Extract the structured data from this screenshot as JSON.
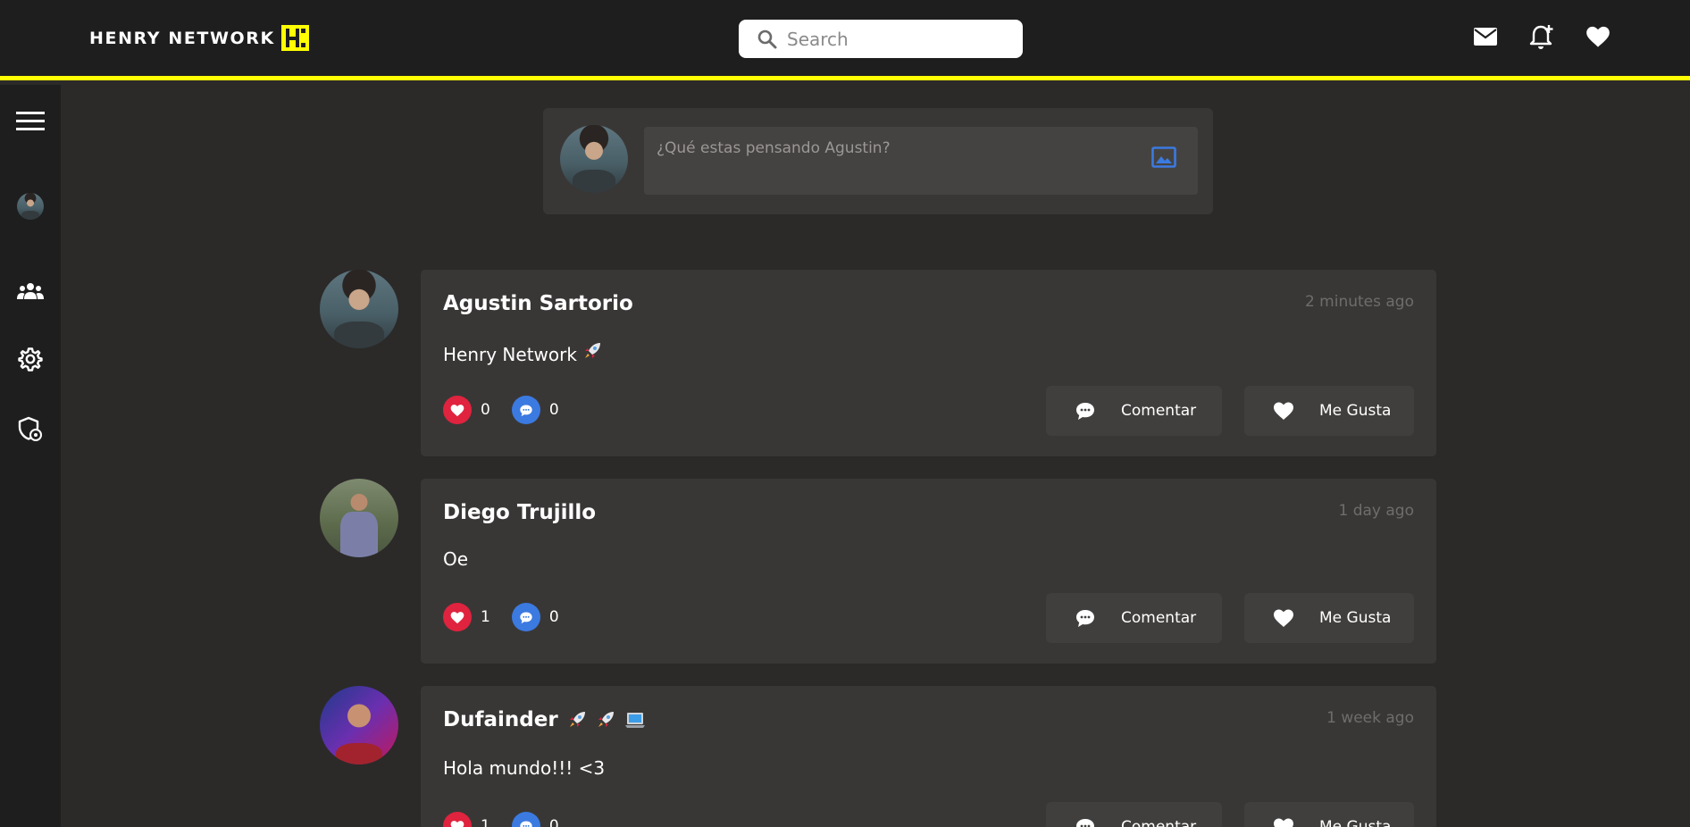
{
  "app": {
    "brand": "HENRY NETWORK",
    "accent_color": "#ffff01"
  },
  "header": {
    "search_placeholder": "Search",
    "icons": [
      "mail-icon",
      "notification-add-icon",
      "heart-icon"
    ]
  },
  "sidebar": {
    "items": [
      {
        "icon": "menu-icon"
      },
      {
        "icon": "profile-avatar"
      },
      {
        "icon": "users-group-icon"
      },
      {
        "icon": "gear-icon"
      },
      {
        "icon": "shield-settings-icon"
      }
    ]
  },
  "composer": {
    "placeholder": "¿Qué estas pensando Agustin?",
    "image_icon": "image-icon"
  },
  "posts": [
    {
      "author": "Agustin Sartorio",
      "author_emoji": "",
      "time": "2 minutes ago",
      "content": "Henry Network",
      "content_emoji": "rocket",
      "likes": "0",
      "comments": "0",
      "comment_label": "Comentar",
      "like_label": "Me Gusta"
    },
    {
      "author": "Diego Trujillo",
      "author_emoji": "",
      "time": "1 day ago",
      "content": "Oe",
      "content_emoji": "",
      "likes": "1",
      "comments": "0",
      "comment_label": "Comentar",
      "like_label": "Me Gusta"
    },
    {
      "author": "Dufainder",
      "author_emoji": "rocket rocket laptop",
      "time": "1 week ago",
      "content": "Hola mundo!!! <3",
      "content_emoji": "",
      "likes": "1",
      "comments": "0",
      "comment_label": "Comentar",
      "like_label": "Me Gusta"
    }
  ]
}
